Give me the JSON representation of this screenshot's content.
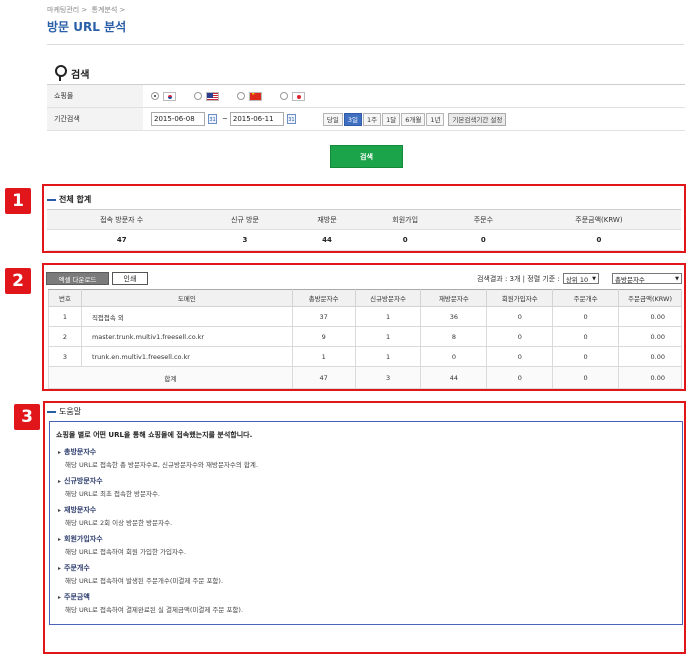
{
  "breadcrumb": [
    "마케팅관리 >",
    "통계분석 >"
  ],
  "page_title": "방문 URL 분석",
  "search": {
    "heading": "검색",
    "mall_label": "쇼핑몰",
    "malls": [
      {
        "flag": "flag-kr",
        "checked": true
      },
      {
        "flag": "flag-us",
        "checked": false
      },
      {
        "flag": "flag-cn",
        "checked": false
      },
      {
        "flag": "flag-jp",
        "checked": false
      }
    ],
    "period_label": "기간검색",
    "date_from": "2015-06-08",
    "date_to": "2015-06-11",
    "tilde": "~",
    "calendar_icon_text": "31",
    "periods": [
      "당일",
      "3일",
      "1주",
      "1달",
      "6개월",
      "1년"
    ],
    "active_period": "3일",
    "default_period_btn": "기본검색기간 설정",
    "search_button": "검색"
  },
  "markers": [
    "1",
    "2",
    "3"
  ],
  "summary": {
    "title": "전체 합계",
    "headers": [
      "접속 방문자 수",
      "신규 방문",
      "재방문",
      "회원가입",
      "주문수",
      "주문금액(KRW)"
    ],
    "values": [
      "47",
      "3",
      "44",
      "0",
      "0",
      "0"
    ]
  },
  "list": {
    "excel_button": "엑셀 다운로드",
    "print_button": "인쇄",
    "result_text": "검색결과 : 3개 | 정렬 기준 :",
    "top_select": "상위 10",
    "sort_select": "총방문자수",
    "headers": [
      "번호",
      "도메인",
      "총방문자수",
      "신규방문자수",
      "재방문자수",
      "회원가입자수",
      "주문개수",
      "주문금액(KRW)"
    ],
    "rows": [
      [
        "1",
        "직접접속 외",
        "37",
        "1",
        "36",
        "0",
        "0",
        "0.00"
      ],
      [
        "2",
        "master.trunk.multiv1.freesell.co.kr",
        "9",
        "1",
        "8",
        "0",
        "0",
        "0.00"
      ],
      [
        "3",
        "trunk.en.multiv1.freesell.co.kr",
        "1",
        "1",
        "0",
        "0",
        "0",
        "0.00"
      ]
    ],
    "total": [
      "합계",
      "47",
      "3",
      "44",
      "0",
      "0",
      "0.00"
    ]
  },
  "help": {
    "title": "도움말",
    "intro": "쇼핑몰 별로 어떤 URL을 통해 쇼핑몰에 접속했는지를 분석합니다.",
    "items": [
      {
        "title": "총방문자수",
        "desc": "해당 URL로 접속한 총 방문자수로, 신규방문자수와 재방문자수의 합계."
      },
      {
        "title": "신규방문자수",
        "desc": "해당 URL로 최초 접속한 방문자수."
      },
      {
        "title": "재방문자수",
        "desc": "해당 URL로 2회 이상 방문한 방문자수."
      },
      {
        "title": "회원가입자수",
        "desc": "해당 URL로 접속하여 회원 가입한 가입자수."
      },
      {
        "title": "주문개수",
        "desc": "해당 URL로 접속하여 발생된 주문개수(미결제 주문 포함)."
      },
      {
        "title": "주문금액",
        "desc": "해당 URL로 접속하여 결제완료된 실 결제금액(미결제 주문 포함)."
      }
    ]
  },
  "colors": {
    "accent": "#2a5ea8",
    "highlight": "#e0161b",
    "search_button": "#1ca44a"
  }
}
